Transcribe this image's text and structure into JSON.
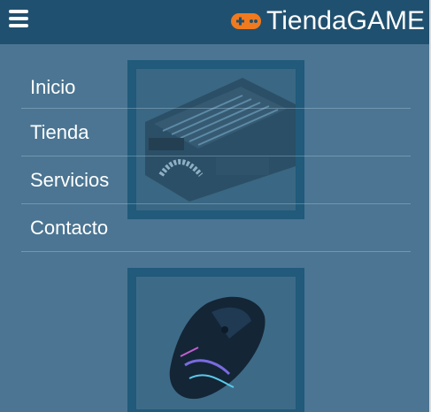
{
  "brand": {
    "name": "TiendaGAME",
    "icon": "gamepad-icon",
    "icon_color": "#f07a1e"
  },
  "menu_toggle": {
    "icon": "hamburger-menu-icon"
  },
  "nav": {
    "items": [
      {
        "label": "Inicio"
      },
      {
        "label": "Tienda"
      },
      {
        "label": "Servicios"
      },
      {
        "label": "Contacto"
      }
    ]
  },
  "products": [
    {
      "image": "graphics-card-image"
    },
    {
      "image": "gaming-mouse-image"
    }
  ],
  "colors": {
    "header": "#20506f",
    "background": "#4b7592",
    "frame": "#215a7a",
    "text": "#ffffff"
  }
}
